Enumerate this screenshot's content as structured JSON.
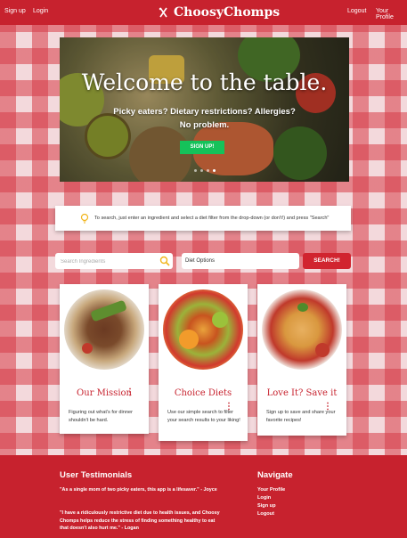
{
  "topbar": {
    "signup": "Sign up",
    "login": "Login",
    "brand": "ChoosyChomps",
    "logout": "Logout",
    "profile": "Your Profile"
  },
  "hero": {
    "title": "Welcome to the table.",
    "subtitle_line1": "Picky eaters? Dietary restrictions? Allergies?",
    "subtitle_line2": "No problem.",
    "button": "SIGN UP!"
  },
  "hint": {
    "text": "To search, just enter an ingredient and select a diet filter from the drop-down (or don't!) and press \"Search\""
  },
  "search": {
    "placeholder": "Search Ingredients",
    "diet_label": "Diet Options",
    "button": "SEARCH!"
  },
  "cards": [
    {
      "title": "Our Mission",
      "text": "Figuring out what's for dinner shouldn't be hard."
    },
    {
      "title": "Choice Diets",
      "text": "Use our simple search to filter your search results to your liking!"
    },
    {
      "title": "Love It? Save it",
      "text": "Sign up to save and share your favorite recipes!"
    }
  ],
  "footer": {
    "testimonials_title": "User Testimonials",
    "quote1": "\"As a single mom of two picky eaters, this app is a lifesaver.\" - Joyce",
    "quote2": "\"I have a ridiculously restrictive diet due to health issues, and Choosy Chomps helps reduce the stress of finding something healthy to eat that doesn't also hurt me.\" - Logan",
    "navigate_title": "Navigate",
    "nav": [
      "Your Profile",
      "Login",
      "Sign up",
      "Logout"
    ]
  },
  "colors": {
    "brand_red": "#c7222e",
    "signup_green": "#15c25a"
  }
}
